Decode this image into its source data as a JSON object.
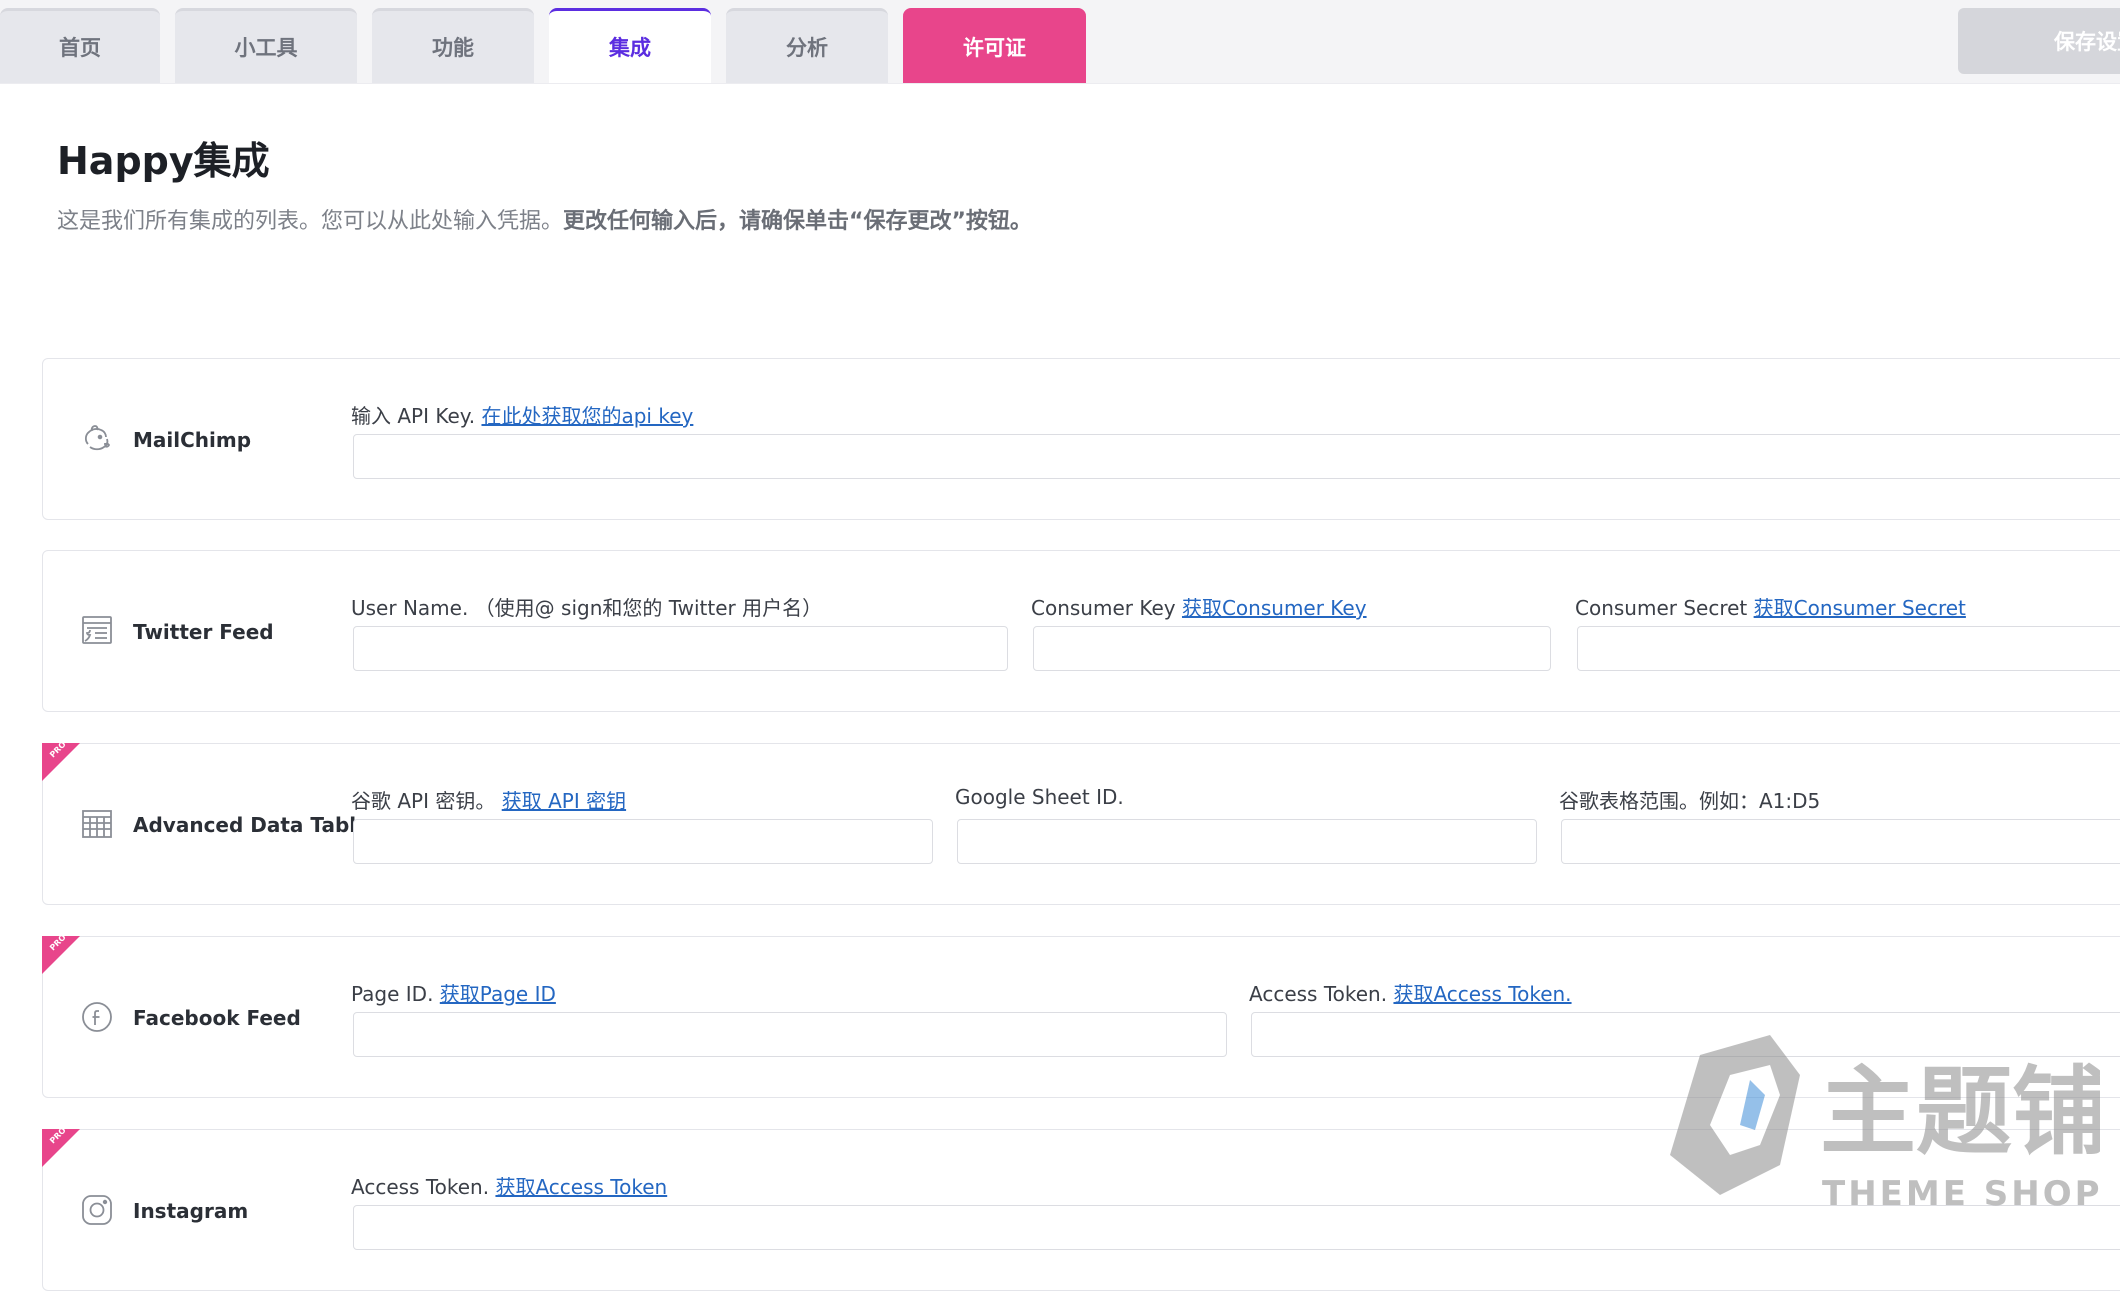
{
  "tabs": [
    {
      "label": "首页"
    },
    {
      "label": "小工具"
    },
    {
      "label": "功能"
    },
    {
      "label": "集成"
    },
    {
      "label": "分析"
    },
    {
      "label": "许可证"
    }
  ],
  "save_button": "保存设置",
  "page": {
    "title": "Happy集成",
    "description_plain": "这是我们所有集成的列表。您可以从此处输入凭据。",
    "description_bold": "更改任何输入后，请确保单击“保存更改”按钮。"
  },
  "integrations": [
    {
      "name": "MailChimp",
      "icon": "mailchimp-icon",
      "pro": false,
      "fields": [
        {
          "label": "输入 API Key. ",
          "link": "在此处获取您的api key",
          "value": ""
        }
      ]
    },
    {
      "name": "Twitter Feed",
      "icon": "twitter-feed-icon",
      "pro": false,
      "fields": [
        {
          "label": "User Name. （使用@ sign和您的 Twitter 用户名）",
          "link": "",
          "value": ""
        },
        {
          "label": "Consumer Key ",
          "link": "获取Consumer Key",
          "value": ""
        },
        {
          "label": "Consumer Secret ",
          "link": "获取Consumer Secret",
          "value": ""
        }
      ]
    },
    {
      "name": "Advanced Data Table",
      "icon": "data-table-icon",
      "pro": true,
      "fields": [
        {
          "label": "谷歌 API 密钥。 ",
          "link": "获取 API 密钥",
          "value": ""
        },
        {
          "label": "Google Sheet ID.",
          "link": "",
          "value": ""
        },
        {
          "label": "谷歌表格范围。例如：A1:D5",
          "link": "",
          "value": ""
        }
      ]
    },
    {
      "name": "Facebook Feed",
      "icon": "facebook-icon",
      "pro": true,
      "fields": [
        {
          "label": "Page ID. ",
          "link": "获取Page ID",
          "value": ""
        },
        {
          "label": "Access Token. ",
          "link": "获取Access Token.",
          "value": ""
        }
      ]
    },
    {
      "name": "Instagram",
      "icon": "instagram-icon",
      "pro": true,
      "fields": [
        {
          "label": "Access Token. ",
          "link": "获取Access Token",
          "value": ""
        }
      ]
    }
  ],
  "pro_badge": "PRO",
  "watermark": {
    "brand": "主题铺",
    "sub": "THEME SHOP"
  },
  "colors": {
    "accent": "#5b2de0",
    "license_tab": "#e8458b",
    "link": "#2467c2",
    "pro_ribbon": "#e8458b"
  }
}
